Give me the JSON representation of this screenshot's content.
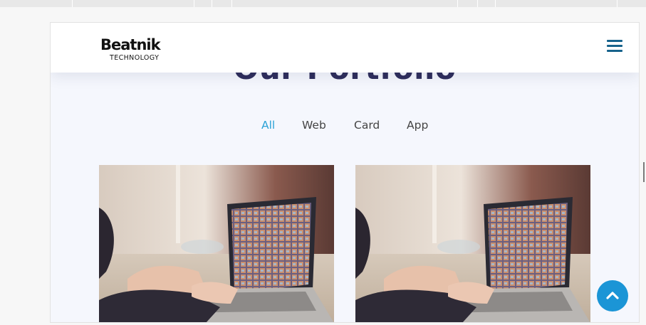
{
  "site": {
    "brand": {
      "name": "Beatnik",
      "tagline": "TECHNOLOGY"
    },
    "section_title": "Our Portfolio",
    "filters": [
      {
        "label": "All",
        "active": true
      },
      {
        "label": "Web",
        "active": false
      },
      {
        "label": "Card",
        "active": false
      },
      {
        "label": "App",
        "active": false
      }
    ],
    "portfolio_items": [
      {
        "image": "laptop-photo"
      },
      {
        "image": "laptop-photo"
      }
    ]
  },
  "icons": {
    "menu": "hamburger-icon",
    "scroll_top": "chevron-up-icon"
  },
  "colors": {
    "accent": "#2ba2d6",
    "title": "#2e2d5c",
    "menu_icon": "#17638c",
    "scroll_button": "#1b95d6",
    "section_bg": "#f5f7fd"
  }
}
